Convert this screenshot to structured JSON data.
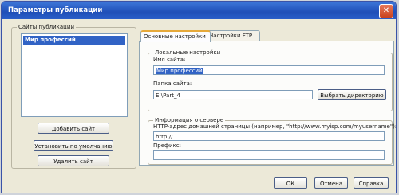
{
  "window": {
    "title": "Параметры публикации"
  },
  "sites_panel": {
    "legend": "Сайты публикации",
    "list_items": [
      "Мир профессий"
    ],
    "buttons": {
      "add": "Добавить сайт",
      "set_default": "Установить по умолчанию",
      "delete": "Удалить сайт"
    }
  },
  "tabs": [
    "Основные настройки",
    "Настройки FTP"
  ],
  "local_settings": {
    "legend": "Локальные настройки",
    "site_name_label": "Имя сайта:",
    "site_name_value": "Мир профессий",
    "site_folder_label": "Папка сайта:",
    "site_folder_value": "E:\\Part_4",
    "browse_button": "Выбрать директорию"
  },
  "server_info": {
    "legend": "Информация о сервере",
    "url_label": "HTTP-адрес домашней страницы (например, \"http://www.myisp.com/myusername\"):",
    "url_value": "http://",
    "prefix_label": "Префикс:",
    "prefix_value": ""
  },
  "footer": {
    "ok": "ОК",
    "cancel": "Отмена",
    "help": "Справка"
  }
}
